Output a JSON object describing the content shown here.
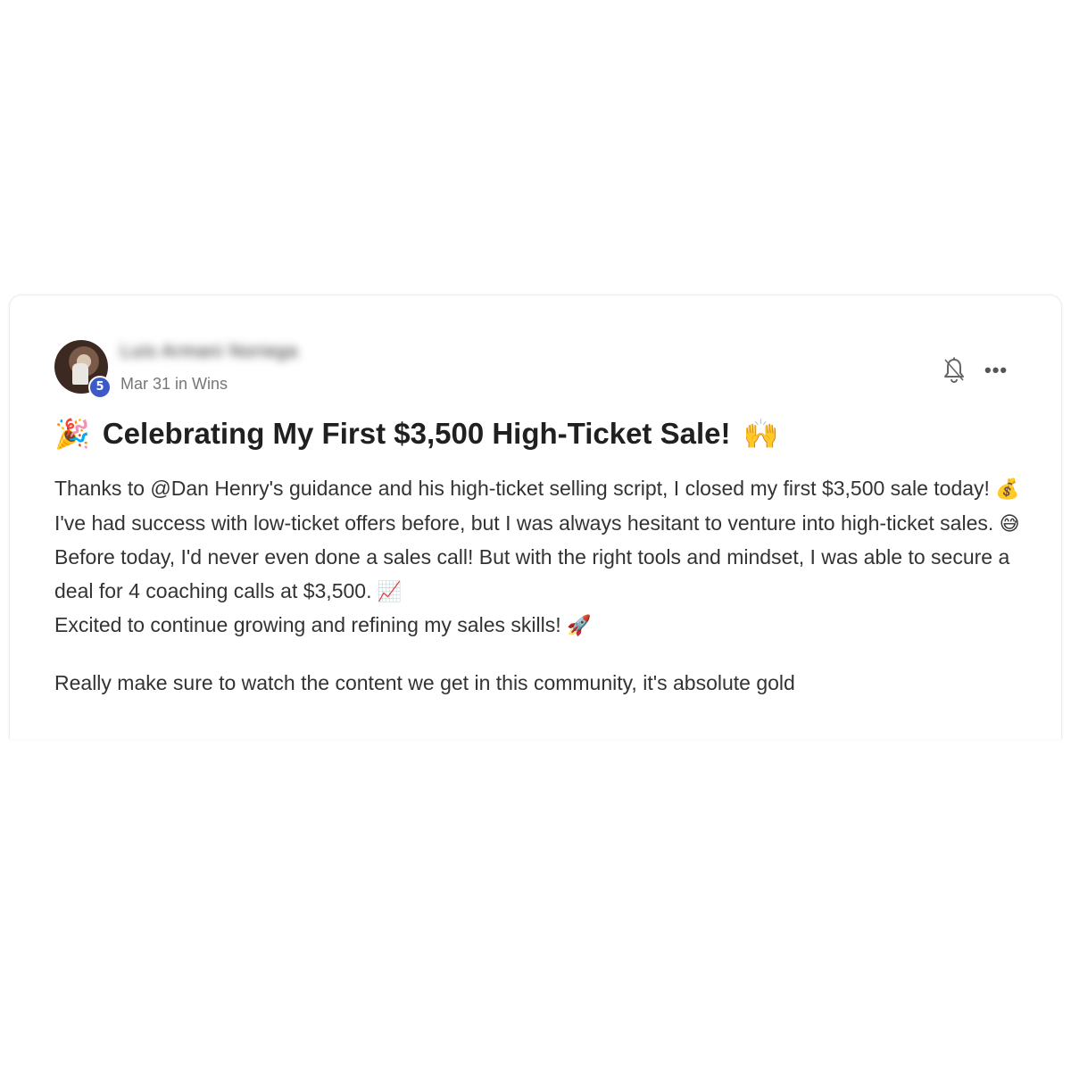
{
  "post": {
    "author": {
      "name": "Luis Armani Noriega",
      "level": "5"
    },
    "meta": {
      "date": "Mar 31",
      "in_word": "in",
      "category": "Wins"
    },
    "actions": {
      "bell_icon": "bell-icon",
      "more_icon": "more-options-icon",
      "more_label": "•••"
    },
    "title": {
      "emoji_lead": "🎉",
      "text": "Celebrating My First $3,500 High-Ticket Sale!",
      "emoji_tail": "🙌"
    },
    "body": {
      "p1_text": "Thanks to @Dan Henry's guidance and his high-ticket selling script, I closed my first $3,500 sale today!",
      "p1_emoji": "💰",
      "p1_text2": "I've had success with low-ticket offers before, but I was always hesitant to venture into high-ticket sales.",
      "p1_emoji2": "😅",
      "p2_text": "Before today, I'd never even done a sales call! But with the right tools and mindset, I was able to secure a deal for 4 coaching calls at $3,500.",
      "p2_emoji": "📈",
      "p3_text": "Excited to continue growing and refining my sales skills!",
      "p3_emoji": "🚀",
      "p4_text": "Really make sure to watch the content we get in this community, it's absolute gold"
    }
  }
}
